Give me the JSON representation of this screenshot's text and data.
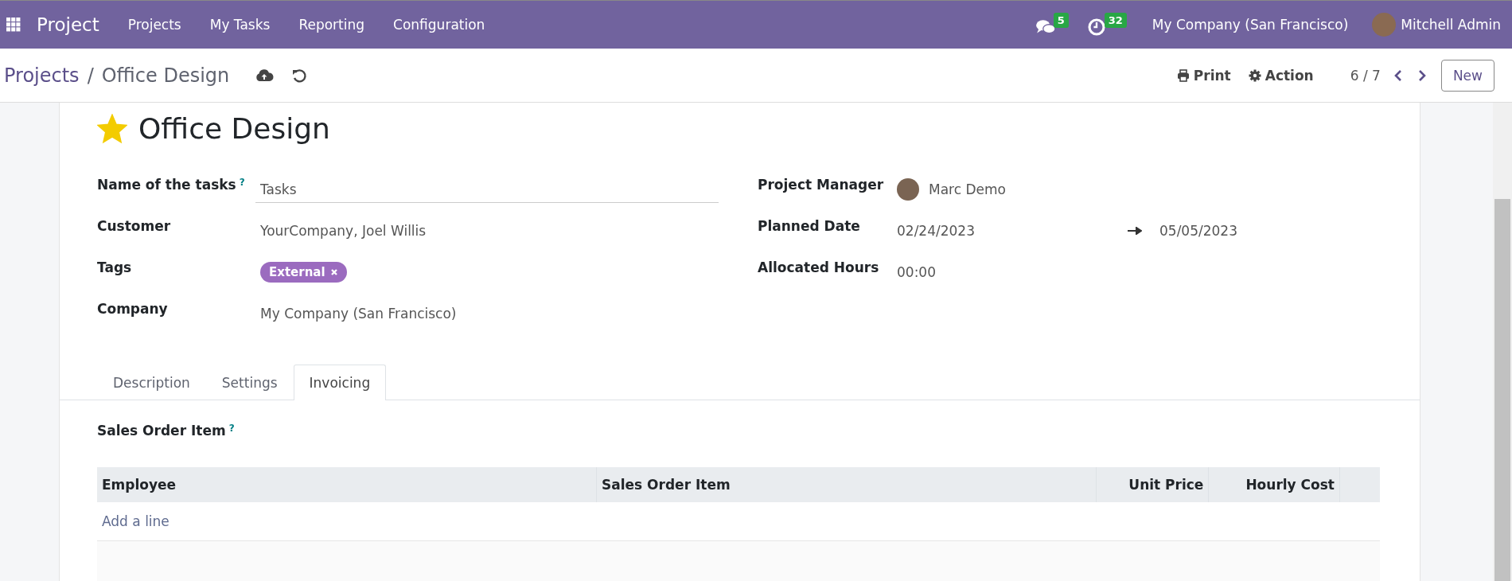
{
  "navbar": {
    "app_name": "Project",
    "menu": [
      "Projects",
      "My Tasks",
      "Reporting",
      "Configuration"
    ],
    "messages_count": "5",
    "activities_count": "32",
    "company": "My Company (San Francisco)",
    "user": "Mitchell Admin"
  },
  "control_panel": {
    "breadcrumb": [
      "Projects",
      "Office Design"
    ],
    "breadcrumb_separator": "/",
    "print": "Print",
    "action": "Action",
    "pager": "6 / 7",
    "new_button": "New"
  },
  "record": {
    "title": "Office Design",
    "favorite": true,
    "left_fields": [
      {
        "label": "Name of the tasks",
        "help": "?",
        "kind": "input",
        "value": "Tasks"
      },
      {
        "label": "Customer",
        "kind": "text",
        "value": "YourCompany, Joel Willis"
      },
      {
        "label": "Tags",
        "kind": "tags",
        "tags": [
          {
            "name": "External",
            "color": "#9b6bbf"
          }
        ]
      },
      {
        "label": "Company",
        "kind": "text",
        "value": "My Company (San Francisco)"
      }
    ],
    "right_fields": [
      {
        "label": "Project Manager",
        "kind": "user",
        "value": "Marc Demo"
      },
      {
        "label": "Planned Date",
        "kind": "daterange",
        "value": "02/24/2023",
        "end": "05/05/2023"
      },
      {
        "label": "Allocated Hours",
        "kind": "text",
        "value": "00:00"
      }
    ]
  },
  "tabs": [
    {
      "label": "Description",
      "selected": false
    },
    {
      "label": "Settings",
      "selected": false
    },
    {
      "label": "Invoicing",
      "selected": true
    }
  ],
  "invoicing": {
    "label": "Sales Order Item",
    "help": "?",
    "table": {
      "columns": [
        {
          "label": "Employee",
          "kind": "text"
        },
        {
          "label": "Sales Order Item",
          "kind": "text"
        },
        {
          "label": "Unit Price",
          "kind": "numeric"
        },
        {
          "label": "Hourly Cost",
          "kind": "numeric"
        }
      ],
      "add_line": "Add a line"
    }
  }
}
